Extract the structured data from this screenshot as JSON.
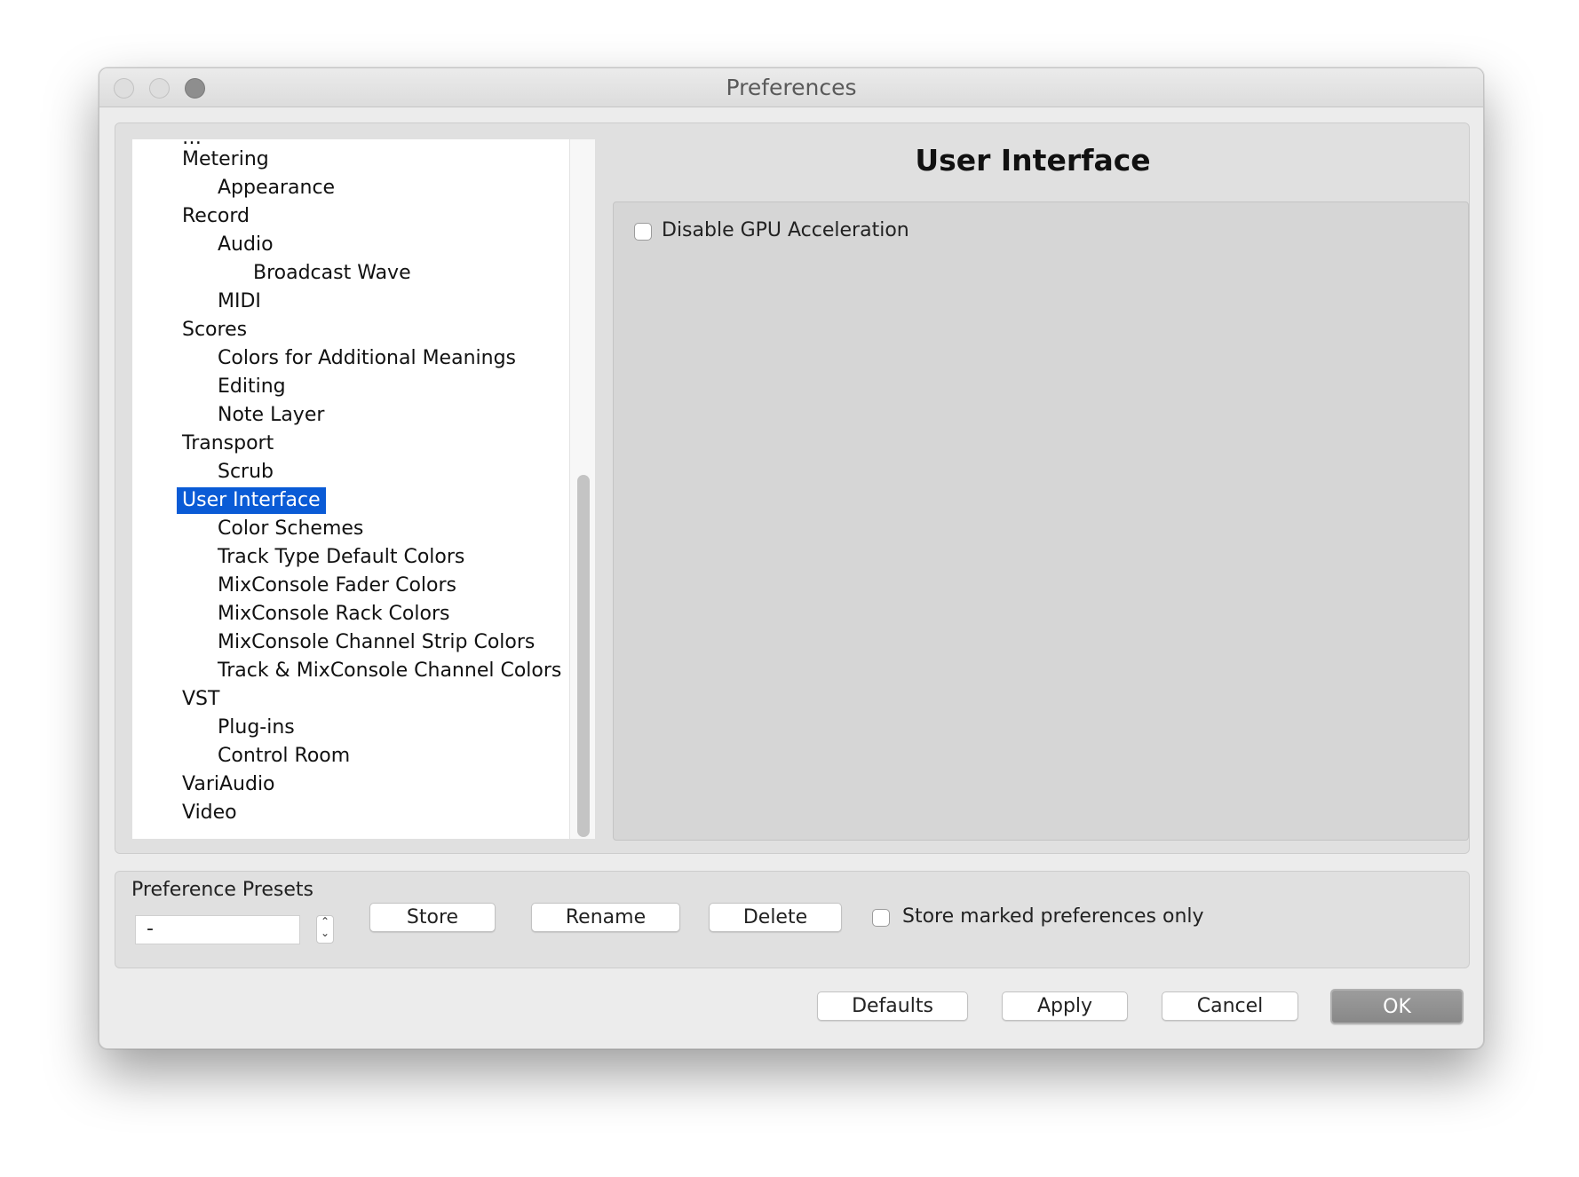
{
  "window": {
    "title": "Preferences"
  },
  "tree": {
    "items": [
      {
        "label": "Metering",
        "level": 1
      },
      {
        "label": "Appearance",
        "level": 2
      },
      {
        "label": "Record",
        "level": 1
      },
      {
        "label": "Audio",
        "level": 2
      },
      {
        "label": "Broadcast Wave",
        "level": 3
      },
      {
        "label": "MIDI",
        "level": 2
      },
      {
        "label": "Scores",
        "level": 1
      },
      {
        "label": "Colors for Additional Meanings",
        "level": 2
      },
      {
        "label": "Editing",
        "level": 2
      },
      {
        "label": "Note Layer",
        "level": 2
      },
      {
        "label": "Transport",
        "level": 1
      },
      {
        "label": "Scrub",
        "level": 2
      },
      {
        "label": "User Interface",
        "level": 1,
        "selected": true
      },
      {
        "label": "Color Schemes",
        "level": 2
      },
      {
        "label": "Track Type Default Colors",
        "level": 2
      },
      {
        "label": "MixConsole Fader Colors",
        "level": 2
      },
      {
        "label": "MixConsole Rack Colors",
        "level": 2
      },
      {
        "label": "MixConsole Channel Strip Colors",
        "level": 2
      },
      {
        "label": "Track & MixConsole Channel Colors",
        "level": 2
      },
      {
        "label": "VST",
        "level": 1
      },
      {
        "label": "Plug-ins",
        "level": 2
      },
      {
        "label": "Control Room",
        "level": 2
      },
      {
        "label": "VariAudio",
        "level": 1
      },
      {
        "label": "Video",
        "level": 1
      }
    ]
  },
  "section": {
    "title": "User Interface",
    "disable_gpu_label": "Disable GPU Acceleration",
    "disable_gpu_checked": false
  },
  "presets": {
    "label": "Preference Presets",
    "current_value": "-",
    "store_label": "Store",
    "rename_label": "Rename",
    "delete_label": "Delete",
    "store_marked_label": "Store marked preferences only",
    "store_marked_checked": false
  },
  "footer": {
    "defaults_label": "Defaults",
    "apply_label": "Apply",
    "cancel_label": "Cancel",
    "ok_label": "OK"
  },
  "colors": {
    "selection": "#0a5bd6",
    "primary_button": "#8e8e8e"
  }
}
